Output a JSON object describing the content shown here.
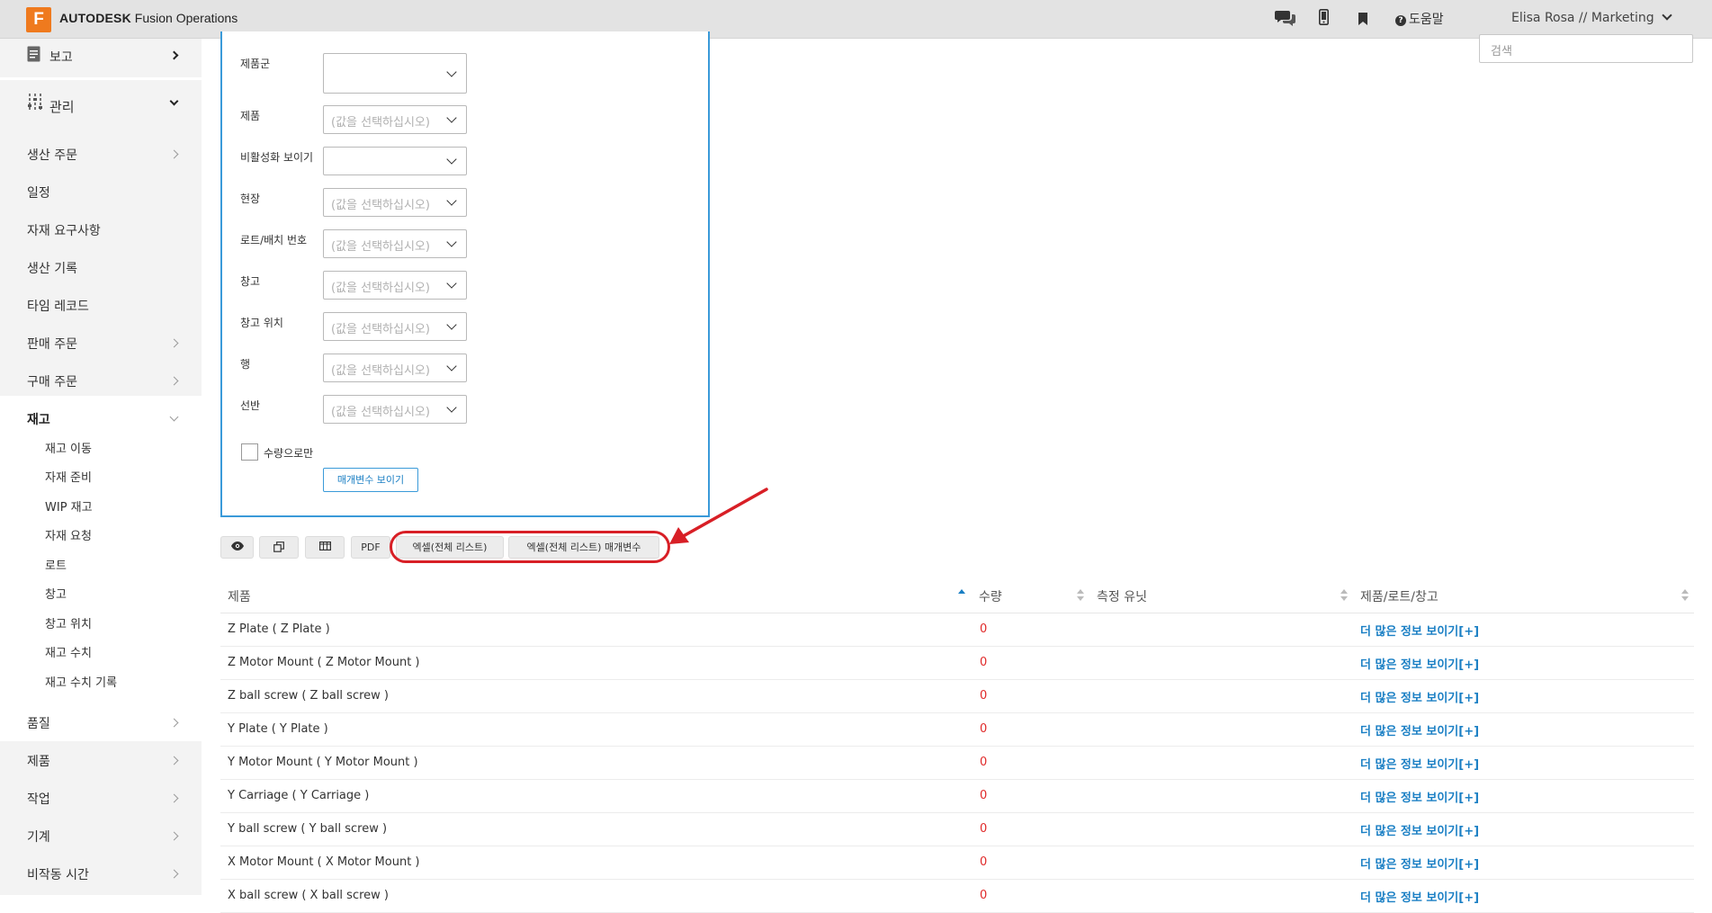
{
  "app": {
    "logo_letter": "F",
    "brand": "AUTODESK",
    "product": "Fusion Operations",
    "help": "도움말",
    "user": "Elisa Rosa // Marketing"
  },
  "search": {
    "placeholder": "검색"
  },
  "sidebar": {
    "report": "보고",
    "manage": "관리",
    "items": [
      "생산 주문",
      "일정",
      "자재 요구사항",
      "생산 기록",
      "타임 레코드",
      "판매 주문",
      "구매 주문"
    ],
    "inventory": "재고",
    "inventory_sub": [
      "재고 이동",
      "자재 준비",
      "WIP 재고",
      "자재 요청",
      "로트",
      "창고",
      "창고 위치",
      "재고 수치",
      "재고 수치 기록"
    ],
    "bottom_items": [
      "품질",
      "제품",
      "작업",
      "기계",
      "비작동 시간"
    ]
  },
  "filters": {
    "fields": [
      {
        "label": "제품군",
        "placeholder": ""
      },
      {
        "label": "제품",
        "placeholder": "(값을 선택하십시오)"
      },
      {
        "label": "비활성화 보이기",
        "placeholder": ""
      },
      {
        "label": "현장",
        "placeholder": "(값을 선택하십시오)"
      },
      {
        "label": "로트/배치 번호",
        "placeholder": "(값을 선택하십시오)"
      },
      {
        "label": "창고",
        "placeholder": "(값을 선택하십시오)"
      },
      {
        "label": "창고 위치",
        "placeholder": "(값을 선택하십시오)"
      },
      {
        "label": "행",
        "placeholder": "(값을 선택하십시오)"
      },
      {
        "label": "선반",
        "placeholder": "(값을 선택하십시오)"
      }
    ],
    "quantity_only": "수량으로만",
    "show_params": "매개변수 보이기"
  },
  "toolbar": {
    "pdf": "PDF",
    "excel": "엑셀(전체 리스트)",
    "excel_params": "엑셀(전체 리스트) 매개변수"
  },
  "table": {
    "headers": [
      "제품",
      "수량",
      "측정 유닛",
      "제품/로트/창고"
    ],
    "rows": [
      {
        "product": "Z Plate ( Z Plate )",
        "qty": "0",
        "link": "더 많은 정보 보이기[+]"
      },
      {
        "product": "Z Motor Mount ( Z Motor Mount )",
        "qty": "0",
        "link": "더 많은 정보 보이기[+]"
      },
      {
        "product": "Z ball screw ( Z ball screw )",
        "qty": "0",
        "link": "더 많은 정보 보이기[+]"
      },
      {
        "product": "Y Plate ( Y Plate )",
        "qty": "0",
        "link": "더 많은 정보 보이기[+]"
      },
      {
        "product": "Y Motor Mount ( Y Motor Mount )",
        "qty": "0",
        "link": "더 많은 정보 보이기[+]"
      },
      {
        "product": "Y Carriage ( Y Carriage )",
        "qty": "0",
        "link": "더 많은 정보 보이기[+]"
      },
      {
        "product": "Y ball screw ( Y ball screw )",
        "qty": "0",
        "link": "더 많은 정보 보이기[+]"
      },
      {
        "product": "X Motor Mount ( X Motor Mount )",
        "qty": "0",
        "link": "더 많은 정보 보이기[+]"
      },
      {
        "product": "X ball screw ( X ball screw )",
        "qty": "0",
        "link": "더 많은 정보 보이기[+]"
      }
    ]
  },
  "colors": {
    "accent": "#1a7fc4",
    "panel_border": "#3a9ad9",
    "highlight": "#d81f26",
    "brand_orange": "#ef7a1e",
    "zero_qty": "#e02a2a"
  }
}
